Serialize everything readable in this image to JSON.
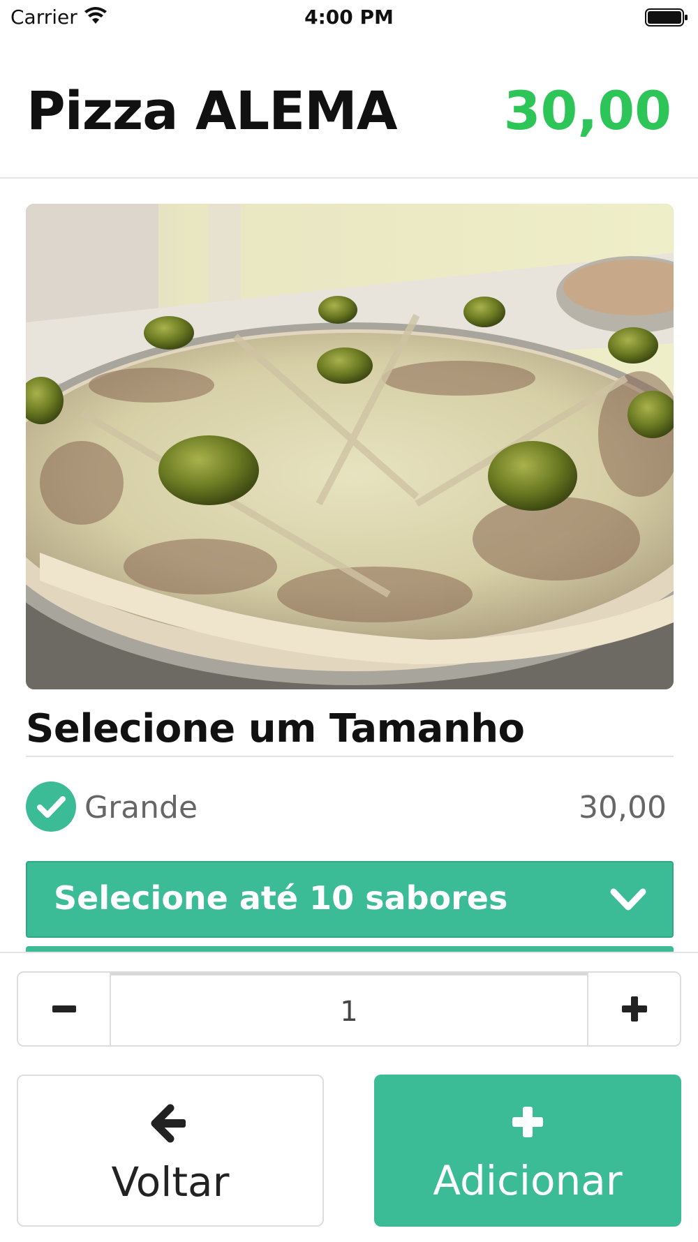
{
  "status_bar": {
    "carrier": "Carrier",
    "time": "4:00 PM"
  },
  "header": {
    "title": "Pizza ALEMA",
    "price": "30,00"
  },
  "product_image": {
    "alt": "Pizza"
  },
  "size_section": {
    "title": "Selecione um Tamanho",
    "options": [
      {
        "label": "Grande",
        "price": "30,00",
        "selected": true
      }
    ]
  },
  "flavors": {
    "label": "Selecione até 10 sabores"
  },
  "quantity": {
    "value": "1",
    "decrement_icon": "minus-icon",
    "increment_icon": "plus-icon"
  },
  "actions": {
    "back_label": "Voltar",
    "back_icon": "arrow-left-icon",
    "add_label": "Adicionar",
    "add_icon": "plus-icon"
  },
  "colors": {
    "accent": "#3bbb96",
    "price": "#2ec558"
  }
}
